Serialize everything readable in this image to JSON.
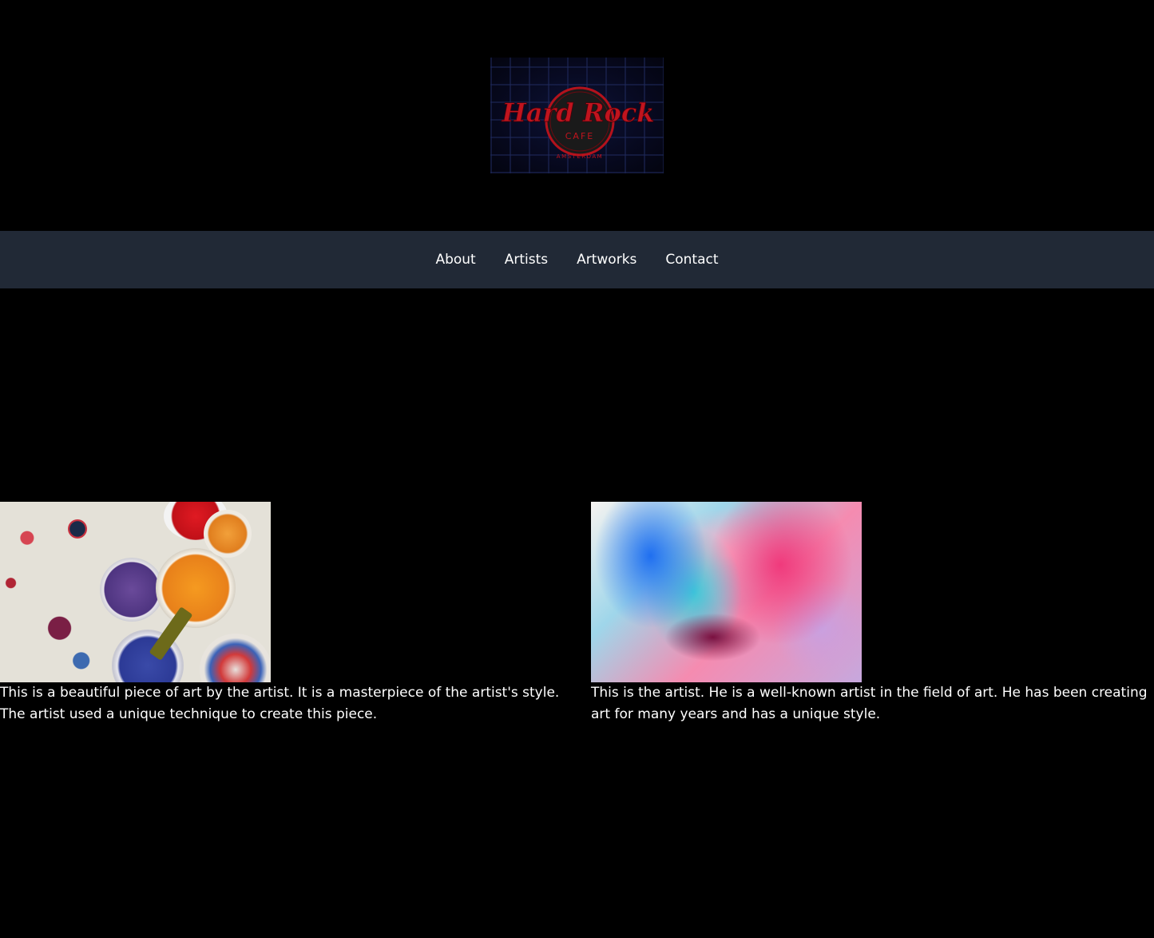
{
  "header": {
    "logo": {
      "alt": "Hard Rock Cafe Amsterdam logo",
      "text_line1": "Hard Rock",
      "text_line2": "CAFE",
      "text_line3": "AMSTERDAM",
      "color": "#c0141e"
    }
  },
  "nav": {
    "items": [
      {
        "label": "About"
      },
      {
        "label": "Artists"
      },
      {
        "label": "Artworks"
      },
      {
        "label": "Contact"
      }
    ],
    "background": "#212936"
  },
  "main": {
    "cards": [
      {
        "image_icon": "paint-buckets-image",
        "text": "This is a beautiful piece of art by the artist. It is a masterpiece of the artist's style. The artist used a unique technique to create this piece."
      },
      {
        "image_icon": "abstract-painting-image",
        "text": "This is the artist. He is a well-known artist in the field of art. He has been creating art for many years and has a unique style."
      }
    ]
  },
  "colors": {
    "page_background": "#000000",
    "text": "#ffffff"
  }
}
